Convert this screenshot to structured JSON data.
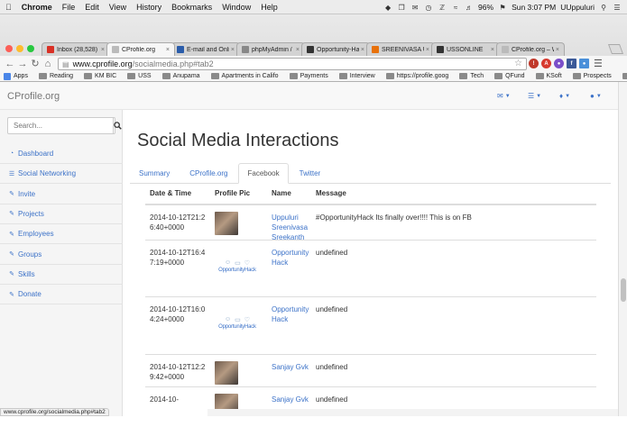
{
  "mac_menu": {
    "apple": "",
    "app_name": "Chrome",
    "items": [
      "File",
      "Edit",
      "View",
      "History",
      "Bookmarks",
      "Window",
      "Help"
    ]
  },
  "mac_status": {
    "battery": "96%",
    "clock": "Sun 3:07 PM",
    "user": "UUppuluri"
  },
  "tabs": [
    {
      "label": "Inbox (28,528)",
      "favicon_color": "#d93025",
      "active": false
    },
    {
      "label": "CProfile.org",
      "favicon_color": "#bbbbbb",
      "active": true
    },
    {
      "label": "E-mail and Onlin",
      "favicon_color": "#2a5caa",
      "active": false
    },
    {
      "label": "phpMyAdmin /",
      "favicon_color": "#888888",
      "active": false
    },
    {
      "label": "Opportunity-Ha",
      "favicon_color": "#333333",
      "active": false
    },
    {
      "label": "SREENIVASA UPP",
      "favicon_color": "#e8710a",
      "active": false
    },
    {
      "label": "USSONLINE",
      "favicon_color": "#333333",
      "active": false
    },
    {
      "label": "CProfile.org – W",
      "favicon_color": "#bbbbbb",
      "active": false
    }
  ],
  "omnibox": {
    "host": "www.cprofile.org",
    "path": "/socialmedia.php#tab2"
  },
  "bookmarks": [
    "Apps",
    "Reading",
    "KM BIC",
    "USS",
    "Anupama",
    "Apartments in Califo",
    "Payments",
    "Interview",
    "https://profile.goog",
    "Tech",
    "QFund",
    "KSoft",
    "Prospects",
    "WHOIS"
  ],
  "site": {
    "brand": "CProfile.org"
  },
  "search": {
    "placeholder": "Search..."
  },
  "sidebar": {
    "items": [
      {
        "label": "Dashboard",
        "icon": "dashboard-icon"
      },
      {
        "label": "Social Networking",
        "icon": "list-icon"
      },
      {
        "label": "Invite",
        "icon": "edit-icon"
      },
      {
        "label": "Projects",
        "icon": "edit-icon"
      },
      {
        "label": "Employees",
        "icon": "edit-icon"
      },
      {
        "label": "Groups",
        "icon": "edit-icon"
      },
      {
        "label": "Skills",
        "icon": "edit-icon"
      },
      {
        "label": "Donate",
        "icon": "edit-icon"
      }
    ]
  },
  "main": {
    "title": "Social Media Interactions",
    "tabs": [
      {
        "label": "Summary",
        "active": false
      },
      {
        "label": "CProfile.org",
        "active": false
      },
      {
        "label": "Facebook",
        "active": true
      },
      {
        "label": "Twitter",
        "active": false
      }
    ]
  },
  "table": {
    "headers": [
      "Date & Time",
      "Profile Pic",
      "Name",
      "Message"
    ],
    "rows": [
      {
        "date": "2014-10-12T21:26:40+0000",
        "pic": "photo",
        "name": "Uppuluri Sreenivasa Sreekanth",
        "message": "#OpportunityHack Its finally over!!!! This is on FB"
      },
      {
        "date": "2014-10-12T16:47:19+0000",
        "pic": "opportunity-hack-logo",
        "name": "Opportunity Hack",
        "message": "undefined"
      },
      {
        "date": "2014-10-12T16:04:24+0000",
        "pic": "opportunity-hack-logo",
        "name": "Opportunity Hack",
        "message": "undefined"
      },
      {
        "date": "2014-10-12T12:29:42+0000",
        "pic": "photo",
        "name": "Sanjay Gvk",
        "message": "undefined"
      },
      {
        "date": "2014-10-",
        "pic": "photo",
        "name": "Sanjay Gvk",
        "message": "undefined"
      }
    ],
    "logo_text": "OpportunityHack"
  },
  "status_bar": {
    "url": "www.cprofile.org/socialmedia.php#tab2"
  },
  "colors": {
    "link": "#3c72c8",
    "sidebar_bg": "#f5f5f5"
  }
}
